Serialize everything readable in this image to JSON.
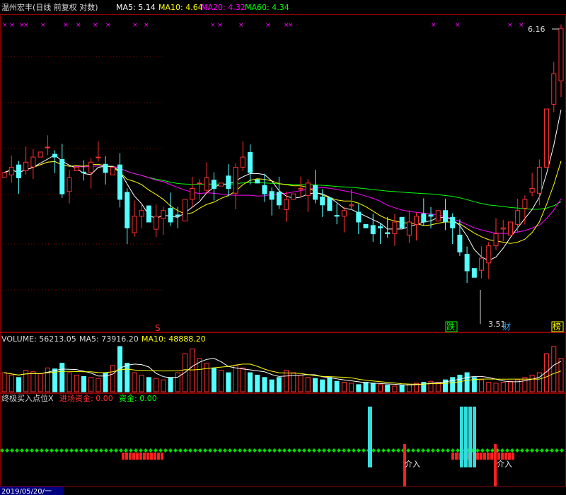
{
  "main": {
    "title": "温州宏丰(日线 前复权 对数)",
    "ma": [
      {
        "label": "MA5: 5.14",
        "color": "#ffffff"
      },
      {
        "label": "MA10: 4.64",
        "color": "#ffff00"
      },
      {
        "label": "MA20: 4.32",
        "color": "#ff00ff"
      },
      {
        "label": "MA60: 4.34",
        "color": "#00ff00"
      }
    ],
    "high_label": "6.16",
    "low_label": "3.51",
    "markers": [
      {
        "text": "S",
        "color": "#ff3030"
      },
      {
        "text": "跌",
        "color": "#00ff00"
      },
      {
        "text": "财",
        "color": "#33aaff"
      },
      {
        "text": "榜",
        "color": "#ffff00"
      }
    ]
  },
  "volume": {
    "label": "VOLUME: 56213.05",
    "ma5_label": "MA5: 73916.20",
    "ma10_label": "MA10: 48888.20"
  },
  "indicator": {
    "name": "终极买入点位X",
    "entry_label": "进场资金: 0.00",
    "fund_label": "资金: 0.00",
    "buy_tags": [
      "介入",
      "介入"
    ]
  },
  "date_label": "2019/05/20/一",
  "colors": {
    "up": "#ff3232",
    "down": "#54ffff",
    "grid": "#8b0000",
    "bg": "#000000"
  },
  "chart_data": {
    "type": "candlestick",
    "title": "温州宏丰(日线 前复权 对数)",
    "price_range_visible": [
      3.51,
      6.16
    ],
    "close_approx": [
      4.55,
      4.6,
      4.5,
      4.65,
      4.7,
      4.75,
      4.8,
      4.7,
      4.35,
      4.5,
      4.6,
      4.55,
      4.65,
      4.7,
      4.55,
      4.6,
      4.3,
      4.05,
      4.15,
      4.2,
      4.1,
      4.15,
      4.2,
      4.1,
      4.15,
      4.3,
      4.4,
      4.45,
      4.5,
      4.4,
      4.45,
      4.4,
      4.6,
      4.7,
      4.55,
      4.45,
      4.35,
      4.3,
      4.25,
      4.3,
      4.35,
      4.4,
      4.45,
      4.3,
      4.25,
      4.2,
      4.15,
      4.2,
      4.25,
      4.1,
      4.05,
      4.0,
      4.05,
      4.0,
      4.1,
      4.05,
      4.1,
      4.15,
      4.1,
      4.15,
      4.2,
      4.1,
      4.05,
      3.85,
      3.7,
      3.65,
      3.8,
      3.9,
      4.0,
      4.05,
      4.1,
      4.2,
      4.3,
      4.4,
      4.6,
      5.2,
      5.6,
      6.16
    ],
    "volume_approx": [
      40,
      35,
      30,
      45,
      42,
      38,
      50,
      48,
      60,
      40,
      35,
      32,
      30,
      28,
      40,
      55,
      95,
      60,
      40,
      35,
      30,
      28,
      25,
      30,
      40,
      80,
      90,
      70,
      60,
      50,
      45,
      40,
      55,
      50,
      40,
      35,
      30,
      25,
      30,
      45,
      40,
      35,
      30,
      28,
      25,
      30,
      22,
      20,
      18,
      15,
      20,
      18,
      15,
      14,
      12,
      14,
      16,
      18,
      20,
      22,
      20,
      25,
      30,
      35,
      40,
      30,
      25,
      20,
      18,
      20,
      22,
      25,
      30,
      35,
      40,
      80,
      95,
      70
    ],
    "volume_ma5": 73916.2,
    "volume_ma10": 48888.2,
    "volume_last": 56213.05
  }
}
